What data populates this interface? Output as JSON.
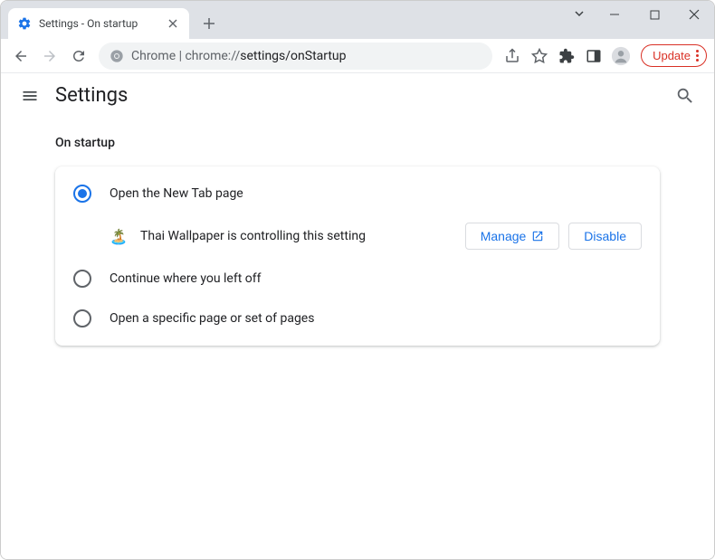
{
  "tab": {
    "title": "Settings - On startup"
  },
  "omnibox": {
    "prefix": "Chrome | chrome://",
    "path": "settings/onStartup"
  },
  "update_label": "Update",
  "page_title": "Settings",
  "section_title": "On startup",
  "options": {
    "new_tab": "Open the New Tab page",
    "continue": "Continue where you left off",
    "specific": "Open a specific page or set of pages"
  },
  "extension": {
    "message": "Thai Wallpaper is controlling this setting",
    "manage": "Manage",
    "disable": "Disable"
  }
}
